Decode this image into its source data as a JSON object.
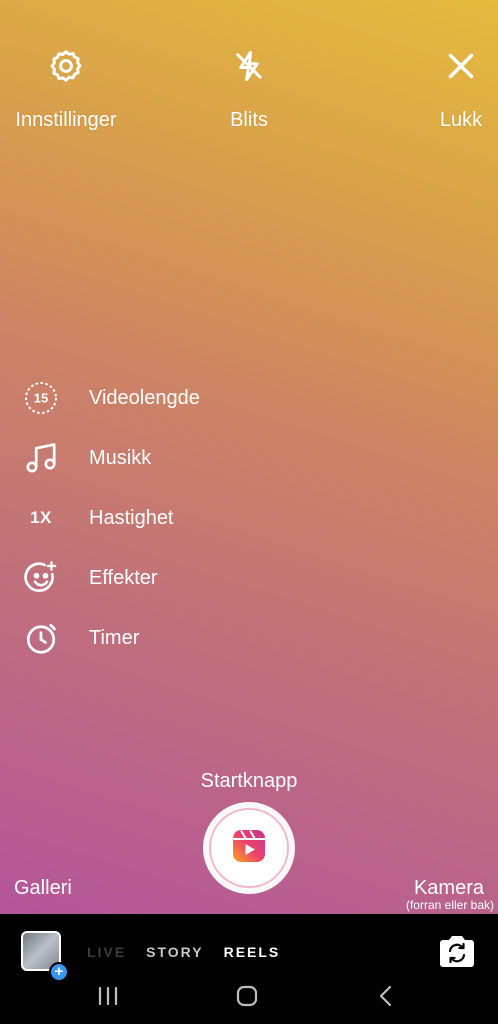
{
  "top_bar": {
    "settings_label": "Innstillinger",
    "flash_label": "Blits",
    "close_label": "Lukk"
  },
  "tools": {
    "video_length_glyph": "15",
    "video_length_label": "Videolengde",
    "music_label": "Musikk",
    "speed_glyph": "1X",
    "speed_label": "Hastighet",
    "effects_label": "Effekter",
    "timer_label": "Timer"
  },
  "capture": {
    "start_label": "Startknapp",
    "gallery_label": "Galleri",
    "camera_label": "Kamera",
    "camera_sub_label": "(forran eller bak)"
  },
  "modes": {
    "live": "LIVE",
    "story": "STORY",
    "reels": "REELS",
    "selected": "REELS"
  },
  "icons": {
    "settings": "gear-icon",
    "flash": "flash-off-icon",
    "close": "close-icon",
    "video_length": "timer-15-icon",
    "music": "music-note-icon",
    "effects": "sparkle-face-icon",
    "timer": "stopwatch-icon",
    "shutter": "reels-icon",
    "flip": "camera-flip-icon",
    "gallery_add": "plus-icon"
  },
  "colors": {
    "gradient_top": "#e5bb3e",
    "gradient_bottom": "#b4569a",
    "accent_blue": "#3897f0"
  }
}
